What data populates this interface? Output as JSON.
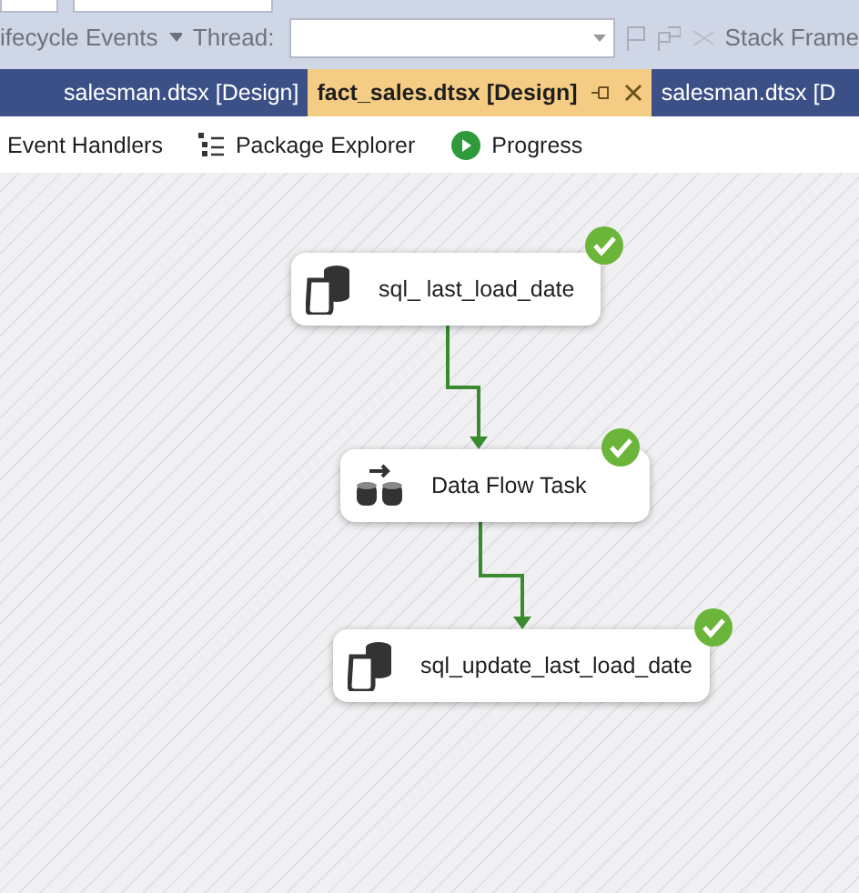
{
  "toolbar": {
    "events_label": "ifecycle Events",
    "thread_label": "Thread:",
    "stack_frame_label": "Stack Frame"
  },
  "tabs": [
    {
      "label": "salesman.dtsx [Design]",
      "selected": false
    },
    {
      "label": "fact_sales.dtsx [Design]",
      "selected": true
    },
    {
      "label": "salesman.dtsx [D",
      "selected": false
    }
  ],
  "designer_tabs": [
    {
      "label": "Event Handlers",
      "kind": "plain"
    },
    {
      "label": "Package Explorer",
      "kind": "explorer"
    },
    {
      "label": "Progress",
      "kind": "progress"
    }
  ],
  "tasks": [
    {
      "label": "sql_ last_load_date",
      "kind": "sql",
      "succeeded": true
    },
    {
      "label": "Data Flow Task",
      "kind": "dataflow",
      "succeeded": true
    },
    {
      "label": "sql_update_last_load_date",
      "kind": "sql",
      "succeeded": true
    }
  ]
}
